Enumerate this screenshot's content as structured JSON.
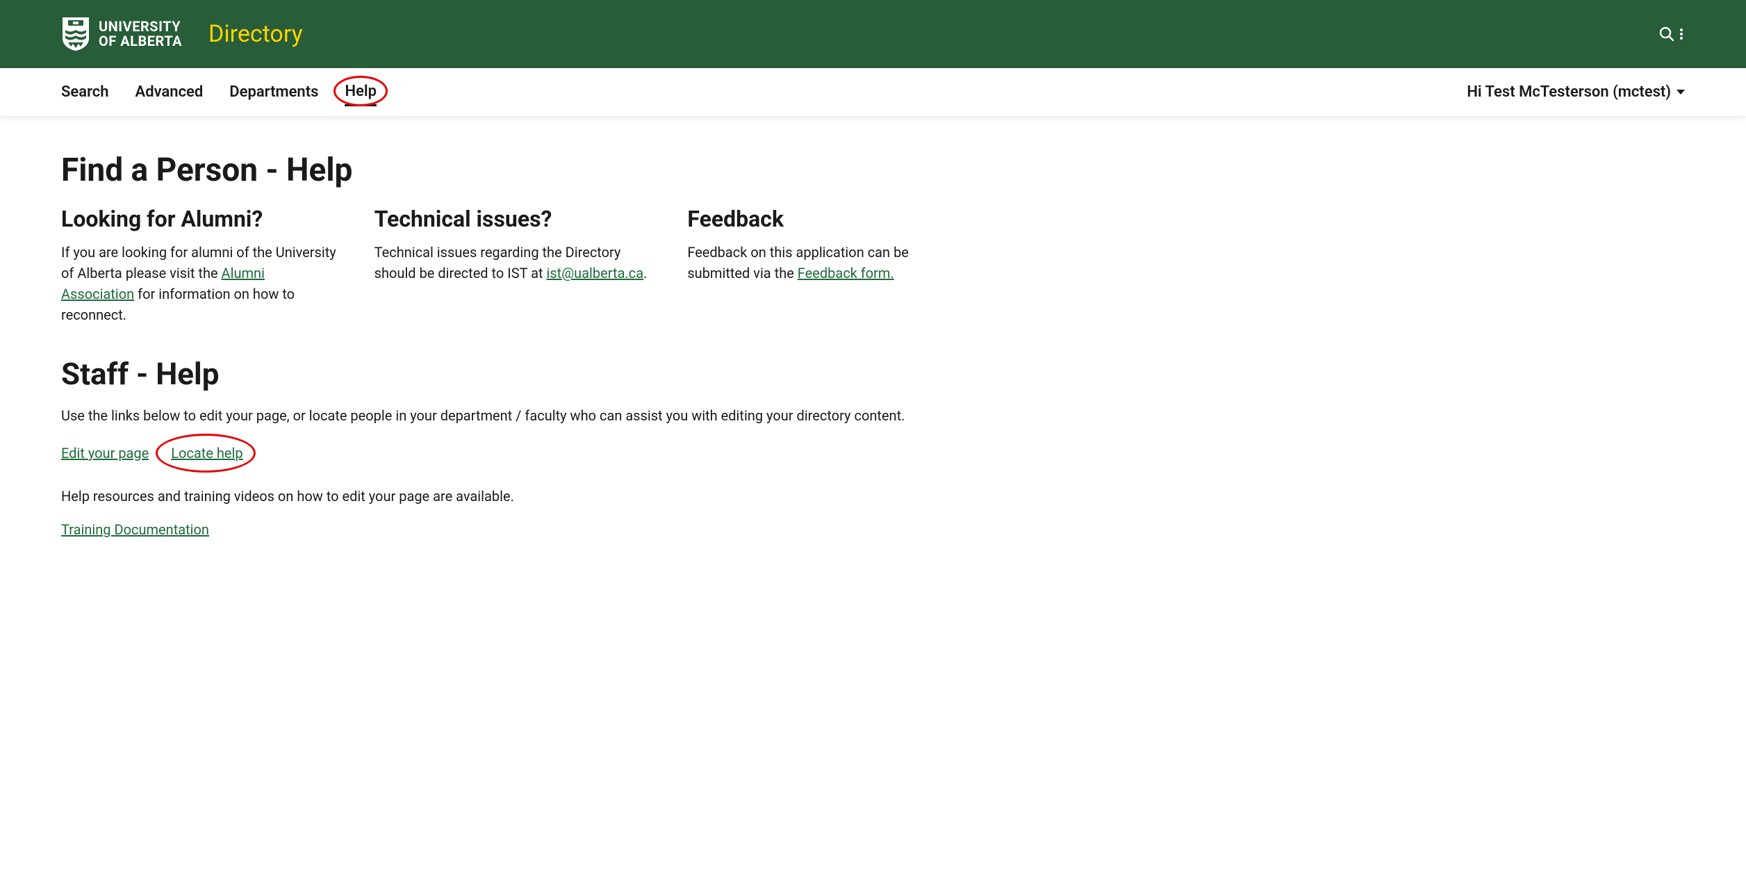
{
  "header": {
    "uni_line1": "UNIVERSITY",
    "uni_line2": "OF ALBERTA",
    "app_title": "Directory"
  },
  "nav": {
    "items": [
      "Search",
      "Advanced",
      "Departments",
      "Help"
    ],
    "active_index": 3,
    "user_greeting": "Hi Test McTesterson (mctest)"
  },
  "page": {
    "title": "Find a Person - Help",
    "columns": [
      {
        "heading": "Looking for Alumni?",
        "text_before": "If you are looking for alumni of the University of Alberta please visit the ",
        "link_text": "Alumni Association",
        "text_after": " for information on how to reconnect."
      },
      {
        "heading": "Technical issues?",
        "text_before": "Technical issues regarding the Directory should be directed to IST at ",
        "link_text": "ist@ualberta.ca",
        "text_after": "."
      },
      {
        "heading": "Feedback",
        "text_before": "Feedback on this application can be submitted via the ",
        "link_text": "Feedback form.",
        "text_after": ""
      }
    ],
    "staff": {
      "title": "Staff - Help",
      "intro": "Use the links below to edit your page, or locate people in your department / faculty who can assist you with editing your directory content.",
      "link_edit": "Edit your page",
      "link_locate": "Locate help",
      "resources_text": "Help resources and training videos on how to edit your page are available.",
      "link_training": "Training Documentation"
    }
  },
  "colors": {
    "brand_green": "#275D38",
    "brand_gold": "#FFD200",
    "link_green": "#1E6B3A",
    "annotation_red": "#E60000"
  }
}
